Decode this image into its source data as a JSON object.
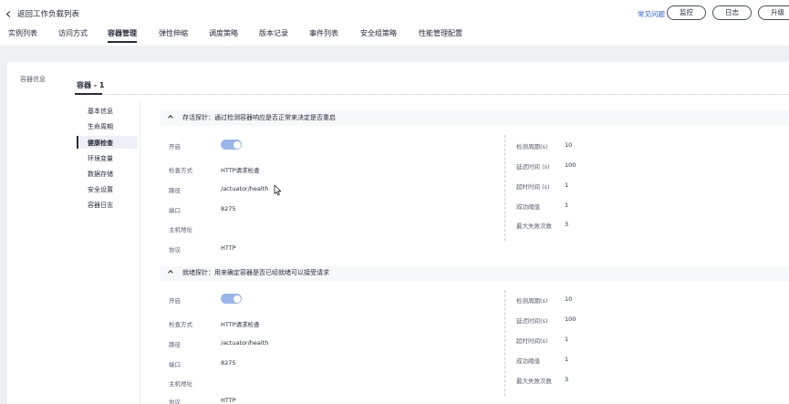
{
  "header": {
    "back_label": "返回工作负载列表",
    "faq_label": "常见问题",
    "monitor_label": "监控",
    "log_label": "日志",
    "upgrade_label": "升级"
  },
  "tabs": [
    {
      "label": "实例列表"
    },
    {
      "label": "访问方式"
    },
    {
      "label": "容器管理"
    },
    {
      "label": "弹性伸缩"
    },
    {
      "label": "调度策略"
    },
    {
      "label": "版本记录"
    },
    {
      "label": "事件列表"
    },
    {
      "label": "安全组策略"
    },
    {
      "label": "性能管理配置"
    }
  ],
  "section_label": "容器信息",
  "container_tab": "容器 - 1",
  "left_nav": [
    {
      "label": "基本信息"
    },
    {
      "label": "生命周期"
    },
    {
      "label": "健康检查"
    },
    {
      "label": "环境变量"
    },
    {
      "label": "数据存储"
    },
    {
      "label": "安全设置"
    },
    {
      "label": "容器日志"
    }
  ],
  "liveness": {
    "title": "存活探针：通过检测容器响应是否正常来决定是否重启",
    "enable_label": "开启",
    "method_label": "检查方式",
    "method_value": "HTTP请求检查",
    "path_label": "路径",
    "path_value": "/actuator/health",
    "port_label": "端口",
    "port_value": "8275",
    "host_label": "主机地址",
    "protocol_label": "协议",
    "protocol_value": "HTTP",
    "period_label": "检测周期(s)",
    "period_value": "10",
    "delay_label": "延迟时间 (s)",
    "delay_value": "100",
    "timeout_label": "超时时间 (s)",
    "timeout_value": "1",
    "success_label": "成功阈值",
    "success_value": "1",
    "failure_label": "最大失败次数",
    "failure_value": "3"
  },
  "readiness": {
    "title": "就绪探针：用来确定容器是否已经就绪可以接受请求",
    "enable_label": "开启",
    "method_label": "检查方式",
    "method_value": "HTTP请求检查",
    "path_label": "路径",
    "path_value": "/actuator/health",
    "port_label": "端口",
    "port_value": "8275",
    "host_label": "主机地址",
    "protocol_label": "协议",
    "protocol_value": "HTTP",
    "period_label": "检测周期(s)",
    "period_value": "10",
    "delay_label": "延迟时间(s)",
    "delay_value": "100",
    "timeout_label": "超时时间(s)",
    "timeout_value": "1",
    "success_label": "成功阈值",
    "success_value": "1",
    "failure_label": "最大失败次数",
    "failure_value": "3"
  },
  "colors": {
    "accent_link": "#2f5fd9",
    "toggle_on": "#9ab5ec",
    "text_primary": "#252b3a"
  }
}
